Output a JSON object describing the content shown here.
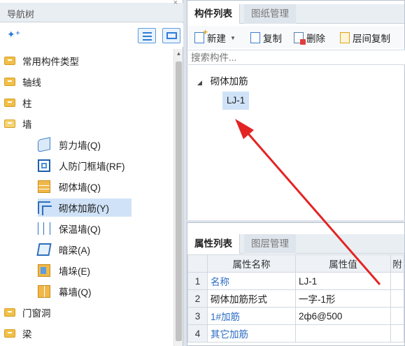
{
  "nav": {
    "title": "导航树",
    "items": [
      {
        "label": "常用构件类型"
      },
      {
        "label": "轴线"
      },
      {
        "label": "柱"
      },
      {
        "label": "墙"
      },
      {
        "label": "剪力墙(Q)"
      },
      {
        "label": "人防门框墙(RF)"
      },
      {
        "label": "砌体墙(Q)"
      },
      {
        "label": "砌体加筋(Y)"
      },
      {
        "label": "保温墙(Q)"
      },
      {
        "label": "暗梁(A)"
      },
      {
        "label": "墙垛(E)"
      },
      {
        "label": "幕墙(Q)"
      },
      {
        "label": "门窗洞"
      },
      {
        "label": "梁"
      }
    ]
  },
  "component_panel": {
    "tabs": [
      {
        "label": "构件列表"
      },
      {
        "label": "图纸管理"
      }
    ],
    "toolbar": {
      "new_label": "新建",
      "copy_label": "复制",
      "delete_label": "删除",
      "floor_copy_label": "层间复制"
    },
    "search": {
      "placeholder": "搜索构件..."
    },
    "tree": {
      "root": "砌体加筋",
      "child": "LJ-1"
    }
  },
  "property_panel": {
    "tabs": [
      {
        "label": "属性列表"
      },
      {
        "label": "图层管理"
      }
    ],
    "columns": {
      "name": "属性名称",
      "value": "属性值",
      "extra": "附"
    },
    "rows": [
      {
        "num": "1",
        "name": "名称",
        "value": "LJ-1"
      },
      {
        "num": "2",
        "name": "砌体加筋形式",
        "value": "一字-1形"
      },
      {
        "num": "3",
        "name": "1#加筋",
        "value": "2ф6@500"
      },
      {
        "num": "4",
        "name": "其它加筋",
        "value": ""
      }
    ]
  },
  "colors": {
    "accent": "#2e7bd6",
    "selection": "#cfe2f7",
    "arrow": "#e32424"
  }
}
